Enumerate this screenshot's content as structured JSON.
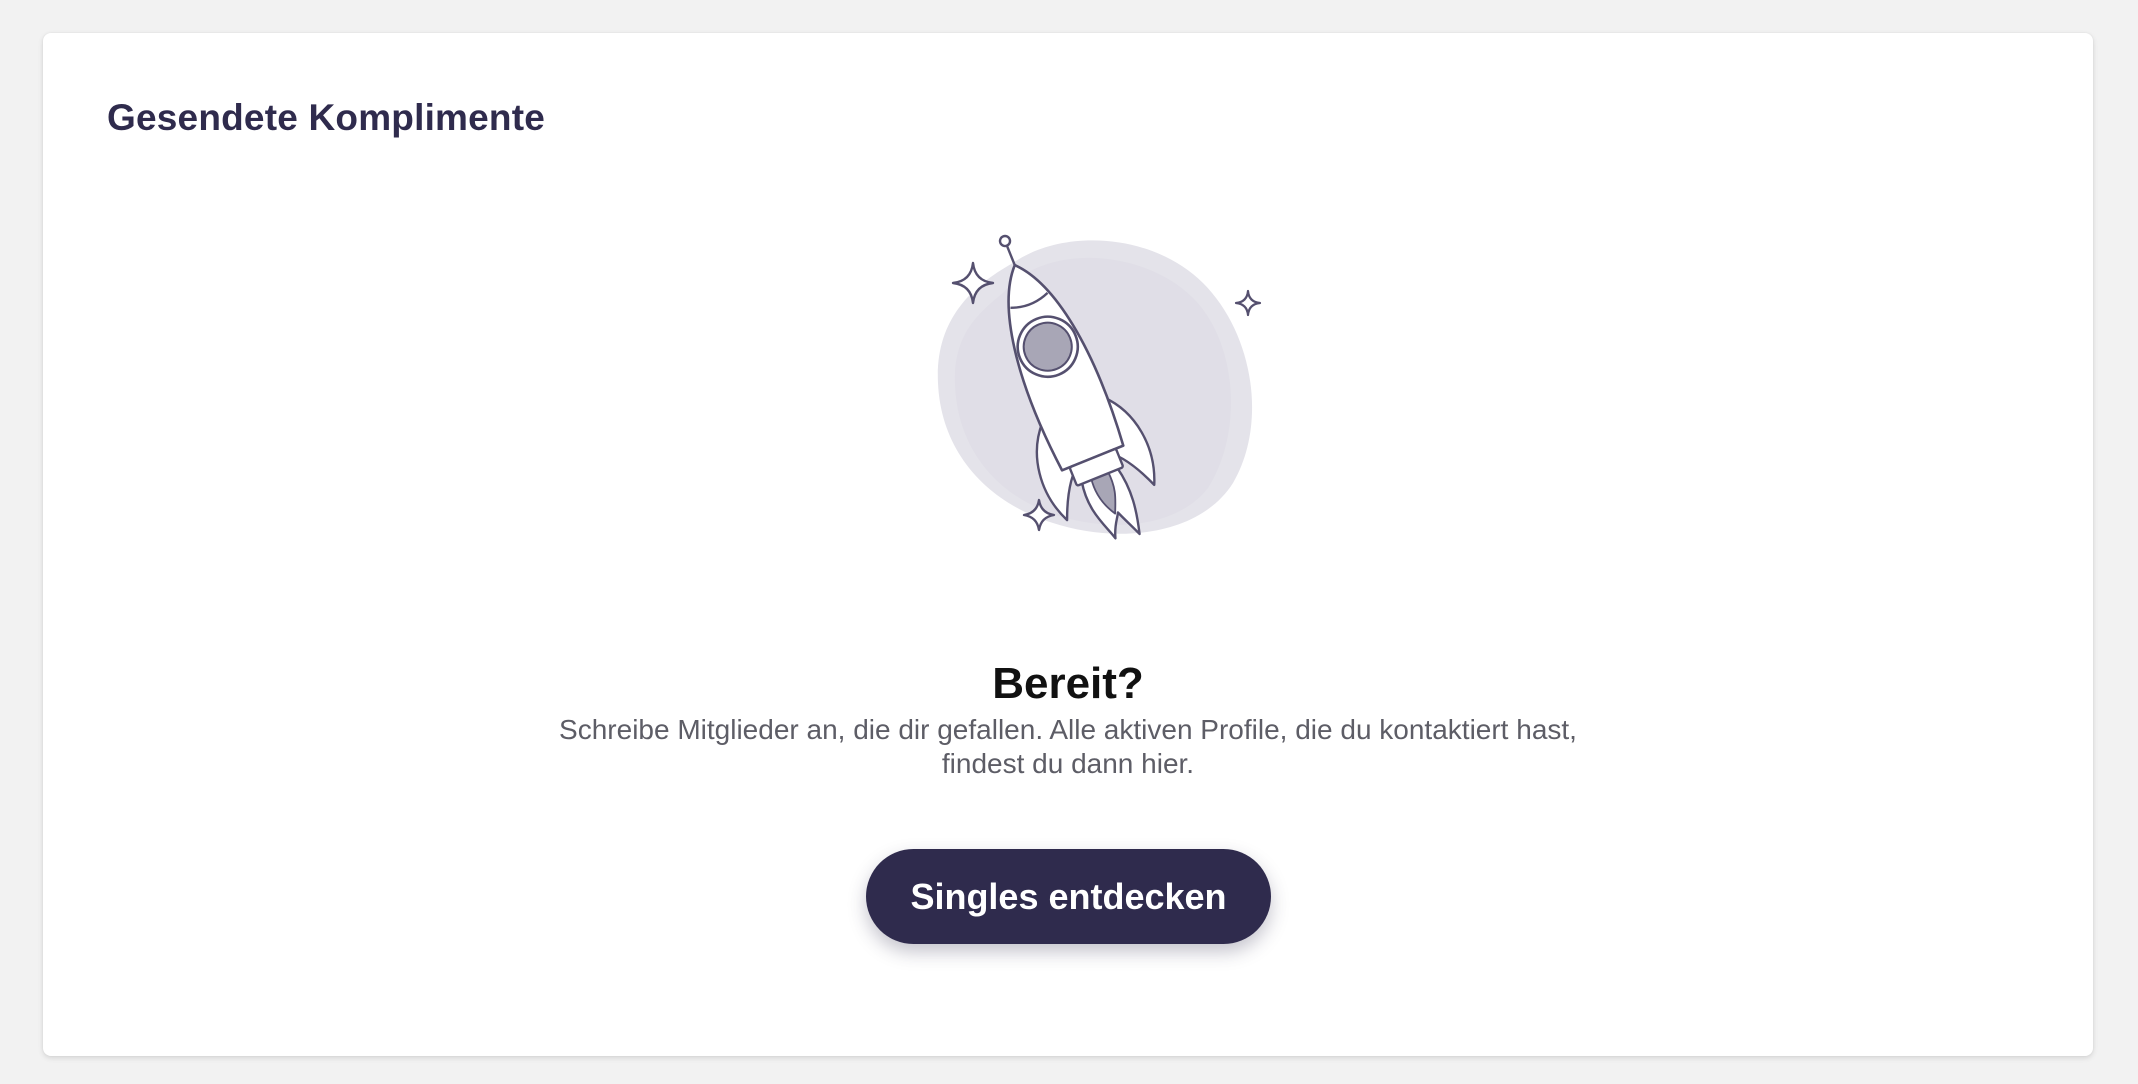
{
  "section": {
    "title": "Gesendete Komplimente"
  },
  "empty_state": {
    "illustration_icon": "rocket-icon",
    "headline": "Bereit?",
    "description": "Schreibe Mitglieder an, die dir gefallen. Alle aktiven Profile, die du kontaktiert hast, findest du dann hier.",
    "cta_label": "Singles entdecken"
  },
  "colors": {
    "primary": "#2f2b4d",
    "background": "#f2f2f2",
    "card": "#ffffff",
    "text_muted": "#5d5d66",
    "illustration_blob": "#e4e3ea"
  }
}
